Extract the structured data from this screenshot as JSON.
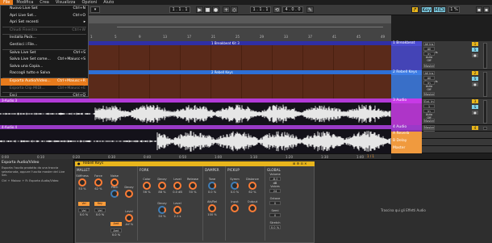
{
  "menubar": {
    "items": [
      "File",
      "Modifica",
      "Crea",
      "Visualizza",
      "Opzioni",
      "Aiuto"
    ],
    "active_index": 0
  },
  "file_menu": {
    "items": [
      {
        "label": "Nuovo Live Set",
        "shortcut": "Ctrl+N",
        "disabled": false
      },
      {
        "label": "Apri Live Set...",
        "shortcut": "Ctrl+O",
        "disabled": false
      },
      {
        "label": "Apri Set recenti",
        "shortcut": "▸",
        "disabled": false
      },
      {
        "label": "Chiudi Finestra",
        "shortcut": "Ctrl+W",
        "disabled": true
      },
      {
        "label": "Installa Pack...",
        "shortcut": "",
        "disabled": false
      },
      {
        "label": "Gestisci i File...",
        "shortcut": "",
        "disabled": false
      },
      {
        "label": "Salva Live Set",
        "shortcut": "Ctrl+S",
        "disabled": false
      },
      {
        "label": "Salva Live Set come...",
        "shortcut": "Ctrl+Maiusc+S",
        "disabled": false
      },
      {
        "label": "Salva una Copia...",
        "shortcut": "",
        "disabled": false
      },
      {
        "label": "Raccogli tutto e Salva",
        "shortcut": "",
        "disabled": false
      },
      {
        "label": "Esporta Audio/Video...",
        "shortcut": "Ctrl+Maiusc+R",
        "disabled": false,
        "selected": true
      },
      {
        "label": "Esporta Clip MIDI...",
        "shortcut": "Ctrl+Maiusc+E",
        "disabled": true
      },
      {
        "label": "Esci",
        "shortcut": "Ctrl+Q",
        "disabled": false
      }
    ]
  },
  "transport": {
    "tempo": "120.00",
    "signature": "4 / 4",
    "position": "1 . 1 . 1",
    "right_position": "1 . 1 . 1",
    "loop_length": "4 . 0 . 0",
    "key_label": "Key",
    "midi_label": "MIDI",
    "cpu": "1 %"
  },
  "tracks": [
    {
      "name": "1 Breakbeat",
      "clip_name": "1 Breakbeat Kit 3",
      "type": "midi",
      "color": "#4b4bd1"
    },
    {
      "name": "2 Rebell Keys",
      "clip_name": "2 Rebell Keys",
      "type": "midi",
      "color": "#3e7ee6"
    },
    {
      "name": "3 Audio",
      "clip_name": "3-Audio 3",
      "type": "audio",
      "color": "#c83ae6"
    },
    {
      "name": "4 Audio",
      "clip_name": "4-Audio 4",
      "type": "audio",
      "color": "#9a3ac8"
    },
    {
      "name": "A Reverb",
      "clip_name": "",
      "type": "return",
      "color": "#f09a3e"
    },
    {
      "name": "B Delay",
      "clip_name": "",
      "type": "return",
      "color": "#f09a3e"
    },
    {
      "name": "Master",
      "clip_name": "",
      "type": "master",
      "color": "#f09a3e"
    }
  ],
  "mixer": {
    "input_labels": [
      "All Ins",
      "All Ins",
      "Ext. In",
      "Ext. In"
    ],
    "channel_labels": [
      "All Channels",
      "All Channels",
      "1",
      "1"
    ],
    "monitor_labels": [
      "In Auto Off",
      "In Auto Off",
      "In Auto Off",
      "In Auto Off"
    ],
    "output_label": "Master",
    "track_numbers": [
      "1",
      "2",
      "3",
      "4",
      "A",
      "B"
    ],
    "sends": [
      "S",
      "S",
      "S",
      "S"
    ]
  },
  "ruler_marks": [
    "1",
    "5",
    "9",
    "13",
    "17",
    "21",
    "25",
    "29",
    "33",
    "37",
    "41",
    "45",
    "49"
  ],
  "time_marks": [
    "0:00",
    "0:10",
    "0:20",
    "0:30",
    "0:40",
    "0:50",
    "1:00",
    "1:10",
    "1:20",
    "1:30",
    "1:40"
  ],
  "status": {
    "zoom": "1 / 1",
    "bar": "1 Bar"
  },
  "info_panel": {
    "title": "Esporta Audio/Video",
    "text": "Esporta l'audio prodotto da una traccia selezionata, oppure l'uscita master del Live Set.",
    "shortcut": "Ctrl + Maiusc + R: Esporta Audio/Video"
  },
  "device": {
    "name": "Rebell Keys",
    "sections": [
      "MALLET",
      "FORK",
      "DAMPER",
      "PICKUP",
      "GLOBAL"
    ],
    "mallet": {
      "knobs": [
        {
          "label": "Stiffness",
          "value": "53 %"
        },
        {
          "label": "Force",
          "value": "62 %"
        },
        {
          "label": "Noise",
          "value": "0.0 %"
        }
      ],
      "noise_labels": [
        "Pitch",
        "Decay",
        "Key"
      ],
      "pills": [
        "Vel",
        "Key",
        "Amt",
        "Vel"
      ],
      "values": [
        "Vel 0.0 %",
        "Vel 0.0 %",
        "Amt 0.0 %"
      ],
      "extra": [
        {
          "label": "Level",
          "value": "-Inf %"
        }
      ]
    },
    "fork": {
      "tine_labels": [
        "Color",
        "Decay",
        "Level"
      ],
      "tone_labels": [
        "Decay",
        "Release"
      ],
      "values": [
        "56 %",
        "88 %",
        "0.0 dB",
        "50 %"
      ],
      "key_values": [
        "50 %",
        "2.1 s"
      ]
    },
    "damper": {
      "labels": [
        "Tone",
        "Att/Rel"
      ],
      "values": [
        "0.0 %",
        "100 %"
      ]
    },
    "pickup": {
      "labels": [
        "Symm",
        "Distance"
      ],
      "values": [
        "0.0 %",
        "62 %"
      ],
      "extra": [
        "Input",
        "Output"
      ]
    },
    "global": {
      "labels": [
        "Volume",
        "Voices",
        "Octave",
        "Semi",
        "Stretch"
      ],
      "values": [
        "-8.0 dB",
        "24",
        "0",
        "0",
        "0.0 %"
      ]
    }
  },
  "drop_hint": "Trascina qui gli Effetti Audio"
}
